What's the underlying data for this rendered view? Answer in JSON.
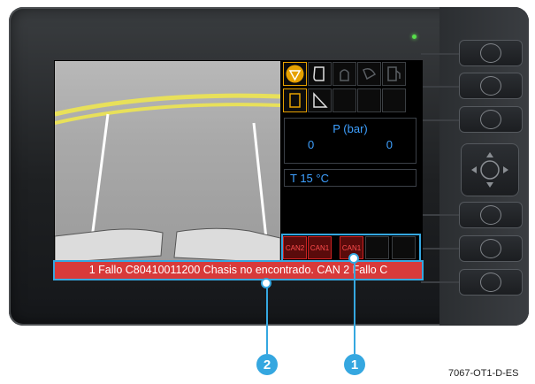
{
  "screen": {
    "pressure": {
      "label": "P (bar)",
      "left_value": "0",
      "right_value": "0"
    },
    "temperature": {
      "label": "T  15 °C"
    },
    "can_indicators": [
      "CAN2",
      "CAN1",
      "CAN1",
      "",
      ""
    ],
    "status_message": "1 Fallo C80410011200 Chasis no encontrado. CAN 2 Fallo C"
  },
  "icons": {
    "row1": [
      "warning-triangle-icon",
      "trailer-icon",
      "beacon-icon",
      "worklight-icon",
      "fuel-icon"
    ],
    "row2": [
      "door-icon",
      "ramp-icon",
      "",
      "",
      ""
    ]
  },
  "callouts": {
    "one": "1",
    "two": "2"
  },
  "figure_code": "7067-OT1-D-ES",
  "colors": {
    "status_bar": "#d83a3a",
    "accent": "#e6a100",
    "readout": "#3ea0ff",
    "callout": "#35a7e0"
  }
}
